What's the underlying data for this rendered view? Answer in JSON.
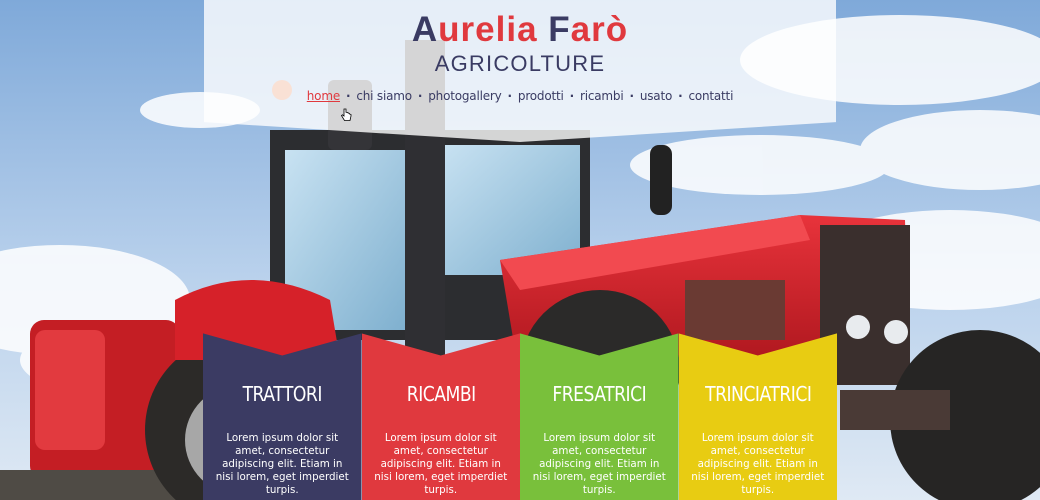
{
  "site": {
    "logo_part_accent_1": "A",
    "logo_part_1": "urelia ",
    "logo_part_accent_2": "F",
    "logo_part_2": "arò",
    "tagline": "AGRICOLTURE"
  },
  "nav": {
    "items": [
      {
        "label": "home",
        "active": true
      },
      {
        "label": "chi siamo",
        "active": false
      },
      {
        "label": "photogallery",
        "active": false
      },
      {
        "label": "prodotti",
        "active": false
      },
      {
        "label": "ricambi",
        "active": false
      },
      {
        "label": "usato",
        "active": false
      },
      {
        "label": "contatti",
        "active": false
      }
    ],
    "separator": "·"
  },
  "tiles": [
    {
      "title": "TRATTORI",
      "text": "Lorem ipsum dolor sit amet, consectetur adipiscing elit. Etiam in nisi lorem, eget imperdiet turpis.",
      "color": "#3b3b63"
    },
    {
      "title": "RICAMBI",
      "text": "Lorem ipsum dolor sit amet, consectetur adipiscing elit. Etiam in nisi lorem, eget imperdiet turpis.",
      "color": "#e0393e"
    },
    {
      "title": "FRESATRICI",
      "text": "Lorem ipsum dolor sit amet, consectetur adipiscing elit. Etiam in nisi lorem, eget imperdiet turpis.",
      "color": "#79c03b"
    },
    {
      "title": "TRINCIATRICI",
      "text": "Lorem ipsum dolor sit amet, consectetur adipiscing elit. Etiam in nisi lorem, eget imperdiet turpis.",
      "color": "#e8cc12"
    }
  ],
  "theme": {
    "navy": "#3a3b63",
    "red": "#e0393e",
    "green": "#79c03b",
    "yellow": "#e8cc12"
  },
  "icons": {
    "cursor": "hand-pointer-icon"
  }
}
